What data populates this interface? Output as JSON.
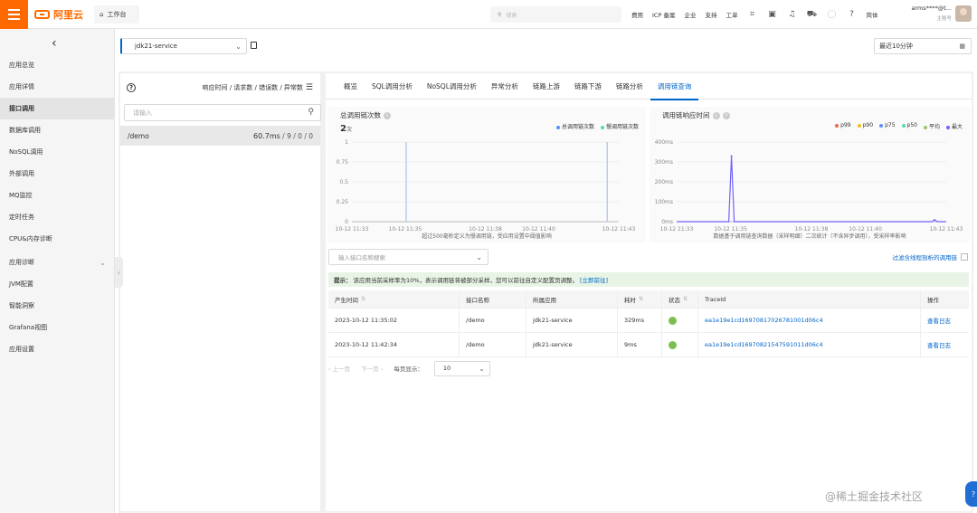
{
  "topbar": {
    "brand": "阿里云",
    "workspace": "工作台",
    "search_placeholder": "搜索",
    "nav": [
      "费用",
      "ICP 备案",
      "企业",
      "支持",
      "工单"
    ],
    "lang": "简体",
    "user_name": "arms****@t...",
    "user_role": "主账号"
  },
  "sidebar": {
    "items": [
      {
        "label": "应用总览"
      },
      {
        "label": "应用详情"
      },
      {
        "label": "接口调用"
      },
      {
        "label": "数据库调用"
      },
      {
        "label": "NoSQL调用"
      },
      {
        "label": "外部调用"
      },
      {
        "label": "MQ监控"
      },
      {
        "label": "定时任务"
      },
      {
        "label": "CPU&内存诊断"
      },
      {
        "label": "应用诊断"
      },
      {
        "label": "JVM配置"
      },
      {
        "label": "智能洞察"
      },
      {
        "label": "Grafana视图"
      },
      {
        "label": "应用设置"
      }
    ],
    "active_index": 2
  },
  "service_select": {
    "value": "jdk21-service"
  },
  "time_select": {
    "value": "最近10分钟"
  },
  "left_panel": {
    "sort_label": "响应时间 / 请求数 / 错误数 / 异常数",
    "search_placeholder": "请输入",
    "rows": [
      {
        "name": "/demo",
        "rt": "60.7ms",
        "rest": " / 9 / 0 / 0"
      }
    ]
  },
  "tabs": [
    "概览",
    "SQL调用分析",
    "NoSQL调用分析",
    "异常分析",
    "链路上游",
    "链路下游",
    "链路分析",
    "调用链查询"
  ],
  "active_tab": 7,
  "chart_data": [
    {
      "type": "bar",
      "title": "总调用链次数",
      "total": "2",
      "total_unit": "次",
      "legend": [
        "总调用链次数",
        "慢调用链次数"
      ],
      "colors": [
        "#5b8ff9",
        "#5ad8a6"
      ],
      "x_ticks": [
        "10-12 11:33",
        "10-12 11:35",
        "10-12 11:38",
        "10-12 11:40",
        "10-12 11:43"
      ],
      "y_ticks": [
        "1",
        "0.75",
        "0.5",
        "0.25",
        "0"
      ],
      "ylim": [
        0,
        1
      ],
      "series": [
        {
          "name": "总调用链次数",
          "points": [
            {
              "x": "10-12 11:35:02",
              "y": 1
            },
            {
              "x": "10-12 11:42:34",
              "y": 1
            }
          ]
        }
      ],
      "footnote": "超过500毫秒定义为慢调用链，受应用设置中阈值影响"
    },
    {
      "type": "line",
      "title": "调用链响应时间",
      "legend": [
        "p99",
        "p90",
        "p75",
        "p50",
        "平均",
        "最大"
      ],
      "colors": [
        "#f4664a",
        "#f6bd16",
        "#5b8ff9",
        "#5ad8a6",
        "#9dc56b",
        "#7262fd"
      ],
      "x_ticks": [
        "10-12 11:33",
        "10-12 11:35",
        "10-12 11:38",
        "10-12 11:40",
        "10-12 11:43"
      ],
      "y_ticks": [
        "400ms",
        "300ms",
        "200ms",
        "100ms",
        "0ms"
      ],
      "ylim": [
        0,
        400
      ],
      "series": [
        {
          "name": "最大",
          "points": [
            {
              "x": "10-12 11:35:02",
              "y": 329
            },
            {
              "x": "10-12 11:42:34",
              "y": 9
            }
          ]
        }
      ],
      "footnote": "数据基于调用链查询数据（采样明细）二次统计（不含异步调用），受采样率影响"
    }
  ],
  "filter": {
    "placeholder": "输入接口名称搜索",
    "checkbox_label": "过滤含线程剖析的调用链"
  },
  "tip": {
    "prefix": "提示：",
    "text": "该应用当前采样率为10%，表示调用链将被部分采样，您可以前往自定义配置页调整。",
    "link": "[立即前往]"
  },
  "table": {
    "headers": [
      "产生时间",
      "接口名称",
      "所属应用",
      "耗时",
      "状态",
      "TraceId",
      "操作"
    ],
    "rows": [
      {
        "time": "2023-10-12 11:35:02",
        "api": "/demo",
        "app": "jdk21-service",
        "cost": "329ms",
        "trace": "ea1e19e1cd16970817026781001d06c4",
        "op": "查看日志"
      },
      {
        "time": "2023-10-12 11:42:34",
        "api": "/demo",
        "app": "jdk21-service",
        "cost": "9ms",
        "trace": "ea1e19e1cd16970821547591011d06c4",
        "op": "查看日志"
      }
    ]
  },
  "pager": {
    "prev": "上一页",
    "next": "下一页",
    "size_label": "每页显示：",
    "size": "10"
  },
  "watermark": "@稀土掘金技术社区"
}
